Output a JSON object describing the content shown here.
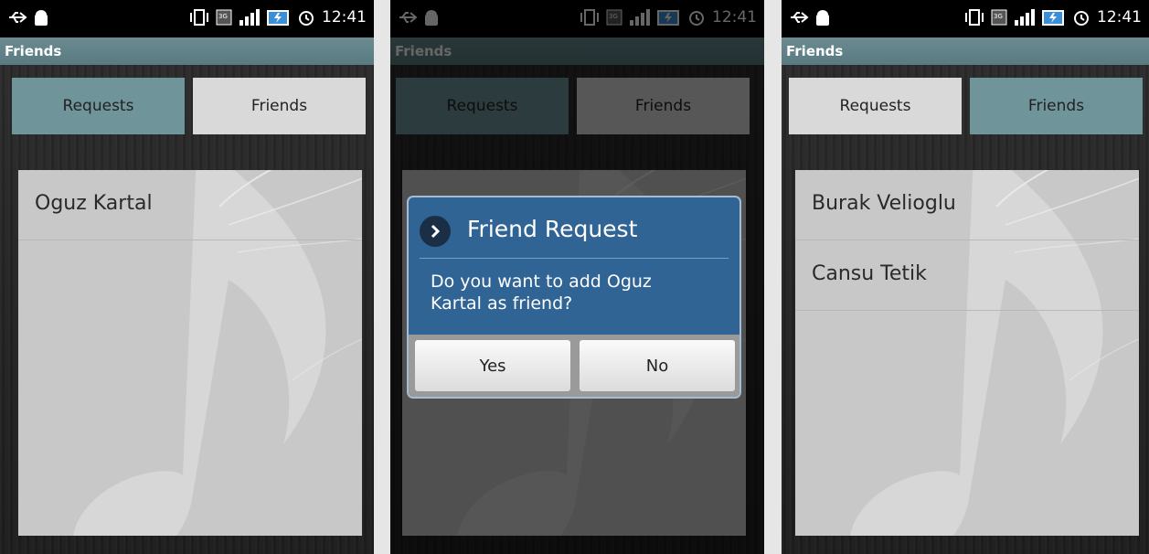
{
  "status": {
    "time": "12:41",
    "network": "3G"
  },
  "app_title": "Friends",
  "tabs": {
    "requests": "Requests",
    "friends": "Friends"
  },
  "screen1": {
    "items": [
      "Oguz Kartal"
    ]
  },
  "dialog": {
    "title": "Friend Request",
    "message": "Do you want to add Oguz Kartal as friend?",
    "yes": "Yes",
    "no": "No"
  },
  "screen3": {
    "items": [
      "Burak Velioglu",
      "Cansu Tetik"
    ]
  },
  "colors": {
    "active_tab": "#6f949a",
    "inactive_tab": "#d9d9d9",
    "dialog": "#2f6495",
    "titlebar": "#587a80"
  }
}
